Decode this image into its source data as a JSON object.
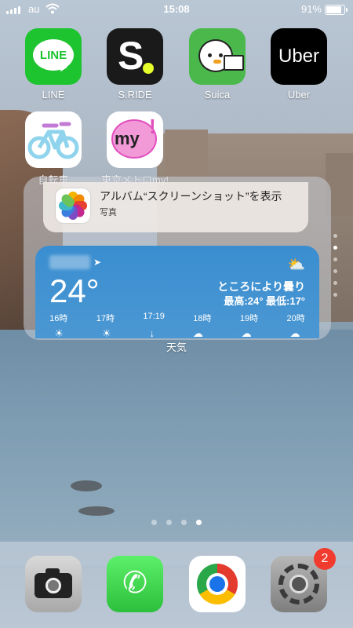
{
  "status_bar": {
    "carrier": "au",
    "time": "15:08",
    "battery_percent": "91%"
  },
  "apps": [
    {
      "label": "LINE",
      "icon_text": "LINE",
      "icon": "line-icon"
    },
    {
      "label": "S.RIDE",
      "icon_text": "S",
      "icon": "sride-icon"
    },
    {
      "label": "Suica",
      "icon": "suica-icon"
    },
    {
      "label": "Uber",
      "icon_text": "Uber",
      "icon": "uber-icon"
    },
    {
      "label": "自転車",
      "icon": "bicycle-icon"
    },
    {
      "label": "東京メトロmy!",
      "icon_text": "my",
      "icon": "tokyo-metro-icon"
    }
  ],
  "photos_widget": {
    "title": "アルバム“スクリーンショット”を表示",
    "app": "写真"
  },
  "weather_widget": {
    "temperature": "24°",
    "condition": "ところにより曇り",
    "high_low": "最高:24° 最低:17°",
    "hours": [
      "16時",
      "17時",
      "17:19",
      "18時",
      "19時",
      "20時"
    ],
    "hour_icons": [
      "sun-icon",
      "sun-icon",
      "sunset-icon",
      "moon-cloud-icon",
      "moon-cloud-icon",
      "cloud-icon"
    ],
    "caption": "天気"
  },
  "page_indicator": {
    "count": 4,
    "active": 4
  },
  "dock": [
    {
      "icon": "camera-icon"
    },
    {
      "icon": "phone-icon"
    },
    {
      "icon": "chrome-icon"
    },
    {
      "icon": "settings-icon",
      "badge": "2"
    }
  ],
  "colors": {
    "line_green": "#1ec430",
    "weather_blue": "#3a8ed0",
    "badge_red": "#f23b2f"
  }
}
